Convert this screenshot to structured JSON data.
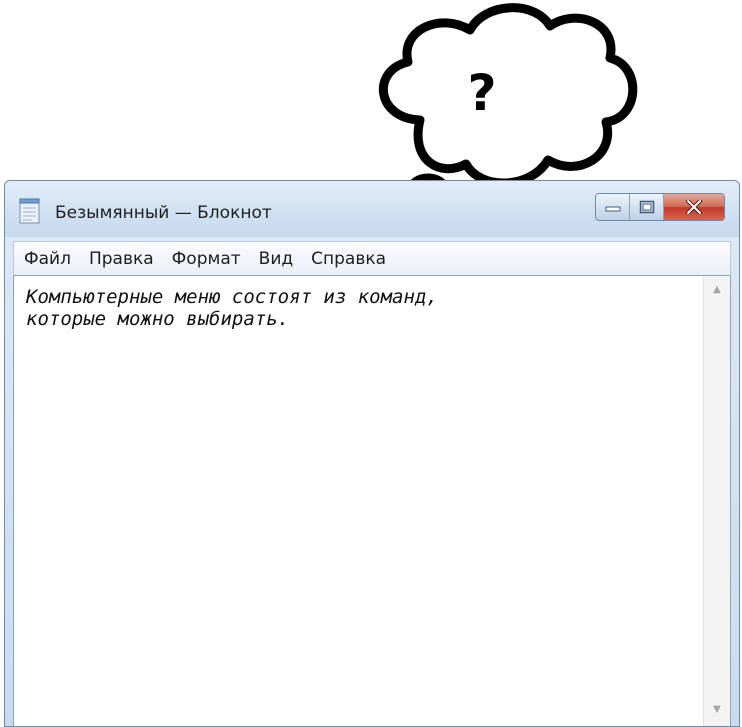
{
  "thought_bubble": {
    "symbol": "?"
  },
  "window": {
    "title": "Безымянный — Блокнот",
    "app_icon": "notepad-icon",
    "caption_buttons": {
      "minimize_icon": "minimize-icon",
      "maximize_icon": "maximize-icon",
      "close_icon": "close-icon"
    }
  },
  "menu": {
    "items": [
      {
        "label": "Файл"
      },
      {
        "label": "Правка"
      },
      {
        "label": "Формат"
      },
      {
        "label": "Вид"
      },
      {
        "label": "Справка"
      }
    ]
  },
  "editor": {
    "text": "Компьютерные меню состоят из команд,\nкоторые можно выбирать.",
    "scroll_up_icon": "scroll-up-arrow-icon",
    "scroll_down_icon": "scroll-down-arrow-icon"
  },
  "colors": {
    "close_button": "#c0392b",
    "frame": "#c9dcef"
  }
}
